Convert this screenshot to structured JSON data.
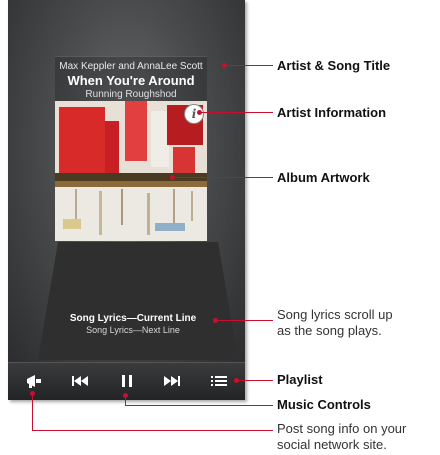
{
  "player": {
    "artist": "Max Keppler and AnnaLee Scott",
    "song_title": "When You're Around",
    "album": "Running Roughshod",
    "lyrics_current": "Song Lyrics—Current Line",
    "lyrics_next": "Song Lyrics—Next Line"
  },
  "icons": {
    "info": "info-icon",
    "share": "megaphone-icon",
    "previous": "skip-previous-icon",
    "pause": "pause-icon",
    "next": "skip-next-icon",
    "playlist": "list-icon"
  },
  "callouts": {
    "artist_title": "Artist & Song Title",
    "artist_info": "Artist Information",
    "album_artwork": "Album Artwork",
    "lyrics_line1": "Song lyrics scroll up",
    "lyrics_line2": "as the song plays.",
    "playlist": "Playlist",
    "music_controls": "Music Controls",
    "post_line1": "Post song info on your",
    "post_line2": "social network site."
  },
  "colors": {
    "leader": "#c8102e",
    "screen": "#4a4c4e"
  }
}
